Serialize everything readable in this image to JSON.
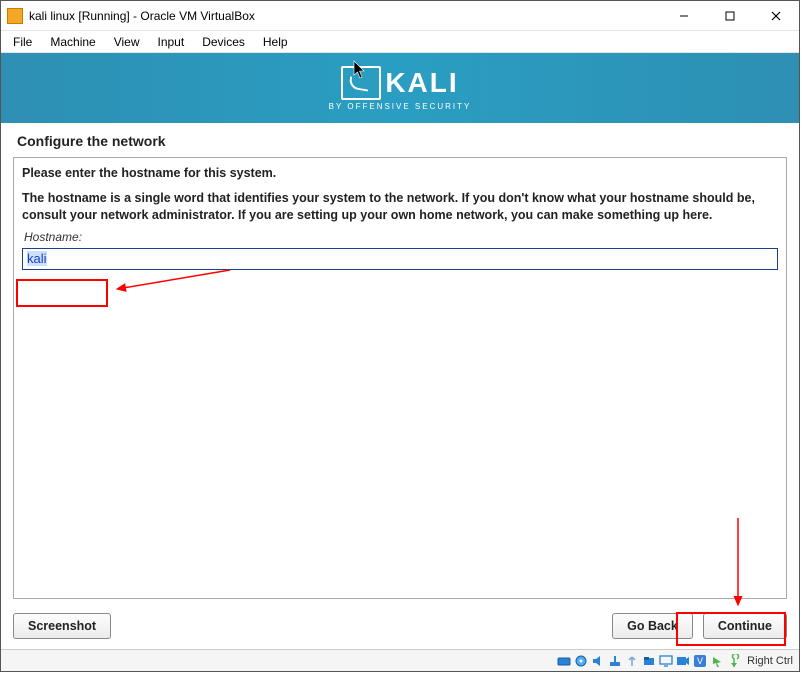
{
  "titlebar": {
    "text": "kali linux [Running] - Oracle VM VirtualBox"
  },
  "menubar": {
    "items": [
      "File",
      "Machine",
      "View",
      "Input",
      "Devices",
      "Help"
    ]
  },
  "banner": {
    "brand": "KALI",
    "sub": "BY OFFENSIVE SECURITY"
  },
  "installer": {
    "stage": "Configure the network",
    "prompt": "Please enter the hostname for this system.",
    "desc": "The hostname is a single word that identifies your system to the network. If you don't know what your hostname should be, consult your network administrator. If you are setting up your own home network, you can make something up here.",
    "field_label": "Hostname:",
    "hostname_value": "kali",
    "buttons": {
      "screenshot": "Screenshot",
      "go_back": "Go Back",
      "continue": "Continue"
    }
  },
  "statusbar": {
    "host_key": "Right Ctrl"
  }
}
